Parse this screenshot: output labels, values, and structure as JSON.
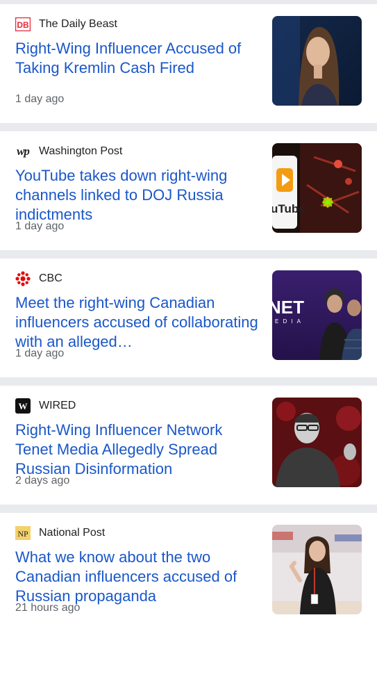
{
  "feed": {
    "items": [
      {
        "source": "The Daily Beast",
        "logo_text": "DB",
        "headline": "Right-Wing Influencer Accused of Taking Kremlin Cash Fired",
        "age": "1 day ago",
        "thumb_icon": "woman-portrait-image"
      },
      {
        "source": "Washington Post",
        "logo_text": "wp",
        "headline": "YouTube takes down right-wing channels linked to DOJ Russia indictments",
        "age": "1 day ago",
        "thumb_icon": "youtube-logo-circuit-image",
        "thumb_text": "uTube"
      },
      {
        "source": "CBC",
        "logo_text": "",
        "headline": "Meet the right-wing Canadian influencers accused of collaborating with an alleged…",
        "age": "1 day ago",
        "thumb_icon": "tenet-media-group-image",
        "thumb_text": "NET",
        "thumb_subtext": "E D I A"
      },
      {
        "source": "WIRED",
        "logo_text": "W",
        "headline": "Right-Wing Influencer Network Tenet Media Allegedly Spread Russian Disinformation",
        "age": "2 days ago",
        "thumb_icon": "man-speaking-image"
      },
      {
        "source": "National Post",
        "logo_text": "NP",
        "headline": "What we know about the two Canadian influencers accused of Russian propaganda",
        "age": "21 hours ago",
        "thumb_icon": "woman-onstage-image"
      }
    ]
  },
  "colors": {
    "headline": "#1a57c9",
    "source": "#202124",
    "meta": "#5f6368",
    "divider": "#e8eaed",
    "daily_beast": "#e4283a",
    "cbc": "#e60505",
    "national_post_bg": "#f3d16b"
  }
}
